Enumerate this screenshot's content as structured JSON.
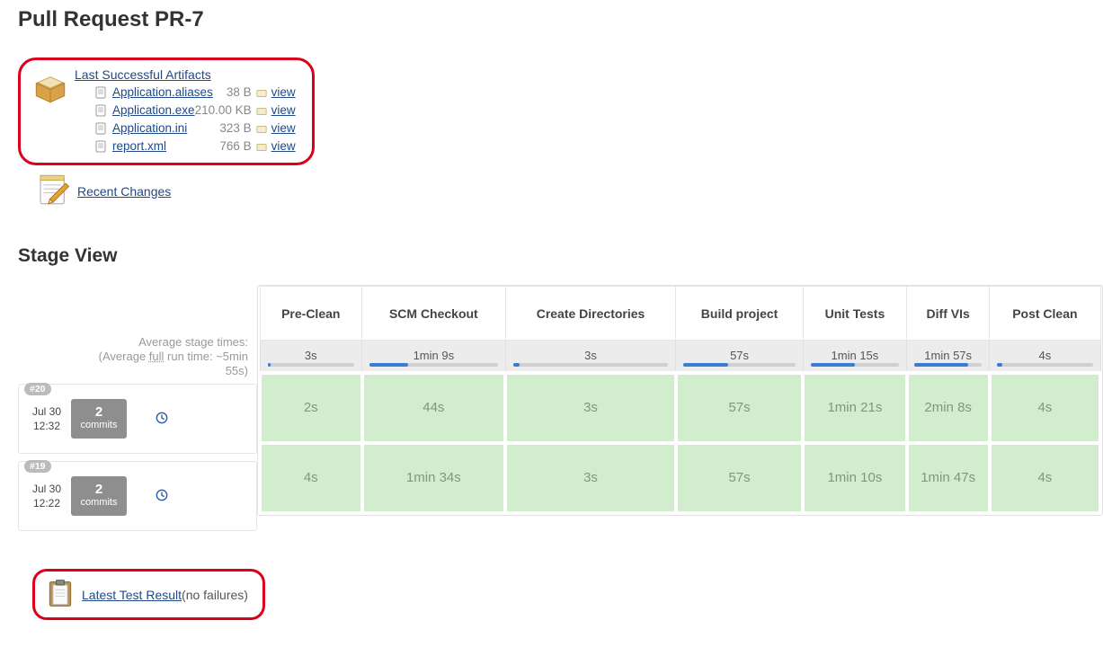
{
  "page_title": "Pull Request PR-7",
  "artifacts": {
    "heading": "Last Successful Artifacts",
    "view_label": "view",
    "items": [
      {
        "name": "Application.aliases",
        "size": "38 B"
      },
      {
        "name": "Application.exe",
        "size": "210.00 KB"
      },
      {
        "name": "Application.ini",
        "size": "323 B"
      },
      {
        "name": "report.xml",
        "size": "766 B"
      }
    ]
  },
  "recent_changes_label": "Recent Changes",
  "stage_view": {
    "title": "Stage View",
    "avg_label_line1": "Average stage times:",
    "avg_label_prefix": "(Average ",
    "avg_label_full": "full",
    "avg_label_suffix": " run time: ~5min",
    "avg_label_line3": "55s)",
    "stages": [
      {
        "name": "Pre-Clean",
        "avg": "3s",
        "bar_pct": 4
      },
      {
        "name": "SCM Checkout",
        "avg": "1min 9s",
        "bar_pct": 30
      },
      {
        "name": "Create Directories",
        "avg": "3s",
        "bar_pct": 4
      },
      {
        "name": "Build project",
        "avg": "57s",
        "bar_pct": 40
      },
      {
        "name": "Unit Tests",
        "avg": "1min 15s",
        "bar_pct": 50
      },
      {
        "name": "Diff VIs",
        "avg": "1min 57s",
        "bar_pct": 80
      },
      {
        "name": "Post Clean",
        "avg": "4s",
        "bar_pct": 5
      }
    ],
    "runs": [
      {
        "badge": "#20",
        "date": "Jul 30",
        "time": "12:32",
        "commits": "2",
        "commits_label": "commits",
        "cells": [
          "2s",
          "44s",
          "3s",
          "57s",
          "1min 21s",
          "2min 8s",
          "4s"
        ]
      },
      {
        "badge": "#19",
        "date": "Jul 30",
        "time": "12:22",
        "commits": "2",
        "commits_label": "commits",
        "cells": [
          "4s",
          "1min 34s",
          "3s",
          "57s",
          "1min 10s",
          "1min 47s",
          "4s"
        ]
      }
    ]
  },
  "test_result": {
    "link": "Latest Test Result",
    "status": " (no failures)"
  }
}
